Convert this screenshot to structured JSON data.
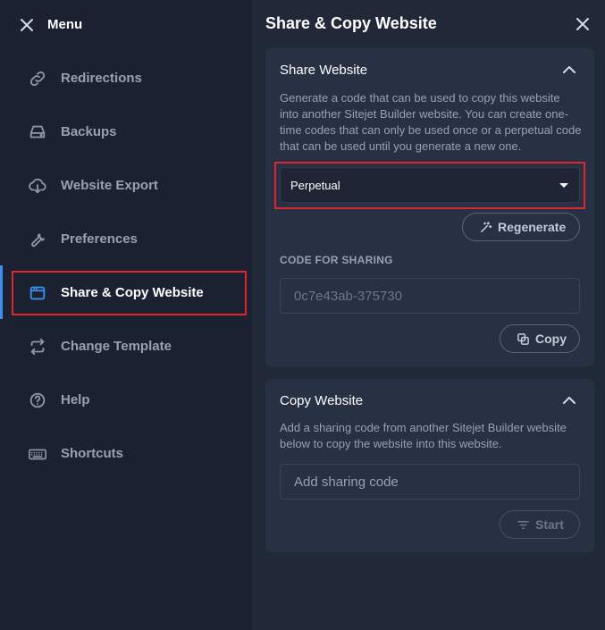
{
  "sidebar": {
    "title": "Menu",
    "items": [
      {
        "label": "Redirections",
        "icon": "link-icon"
      },
      {
        "label": "Backups",
        "icon": "backup-drive-icon"
      },
      {
        "label": "Website Export",
        "icon": "cloud-download-icon"
      },
      {
        "label": "Preferences",
        "icon": "wrench-icon"
      },
      {
        "label": "Share & Copy Website",
        "icon": "browser-window-icon",
        "active": true
      },
      {
        "label": "Change Template",
        "icon": "swap-arrows-icon"
      },
      {
        "label": "Help",
        "icon": "help-circle-icon"
      },
      {
        "label": "Shortcuts",
        "icon": "keyboard-icon"
      }
    ]
  },
  "panel": {
    "title": "Share & Copy Website",
    "share": {
      "title": "Share Website",
      "description": "Generate a code that can be used to copy this website into another Sitejet Builder website. You can create one-time codes that can only be used once or a perpetual code that can be used until you generate a new one.",
      "select_value": "Perpetual",
      "regenerate_label": "Regenerate",
      "code_label": "CODE FOR SHARING",
      "code_placeholder": "0c7e43ab-375730",
      "copy_label": "Copy"
    },
    "copy": {
      "title": "Copy Website",
      "description": "Add a sharing code from another Sitejet Builder website below to copy the website into this website.",
      "input_placeholder": "Add sharing code",
      "start_label": "Start"
    }
  },
  "colors": {
    "accent": "#3e8ff0",
    "highlight": "#e0262d",
    "sidebar_bg": "#1b2130",
    "panel_bg": "#212838",
    "card_bg": "#283044"
  }
}
